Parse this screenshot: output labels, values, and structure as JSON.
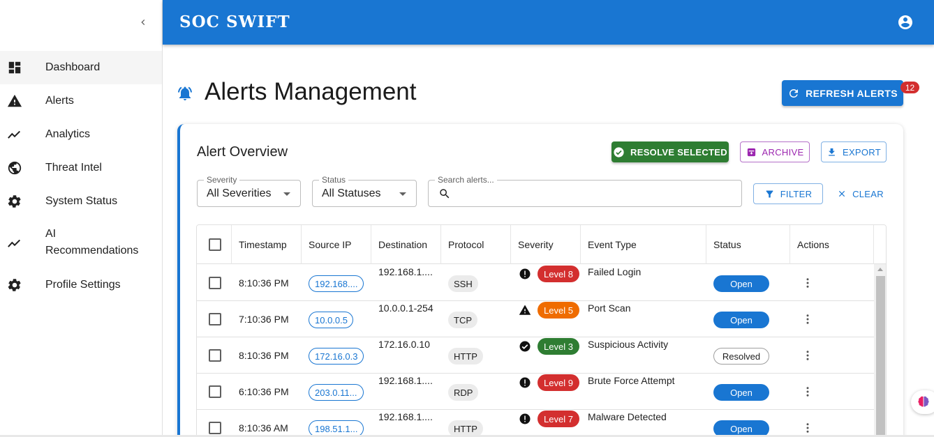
{
  "app": {
    "brand": "SOC SWIFT"
  },
  "sidebar": {
    "items": [
      {
        "label": "Dashboard",
        "icon": "dashboard-icon",
        "active": true
      },
      {
        "label": "Alerts",
        "icon": "warning-icon"
      },
      {
        "label": "Analytics",
        "icon": "trending-icon"
      },
      {
        "label": "Threat Intel",
        "icon": "globe-icon"
      },
      {
        "label": "System Status",
        "icon": "gear-icon"
      },
      {
        "label_line1": "AI",
        "label_line2": "Recommendations",
        "icon": "trending-icon"
      },
      {
        "label": "Profile Settings",
        "icon": "gear-icon"
      }
    ]
  },
  "header": {
    "title": "Alerts Management",
    "refresh_label": "REFRESH ALERTS",
    "badge_count": "12"
  },
  "card": {
    "title": "Alert Overview",
    "resolve_label": "RESOLVE SELECTED",
    "archive_label": "ARCHIVE",
    "export_label": "EXPORT"
  },
  "filters": {
    "severity": {
      "label": "Severity",
      "value": "All Severities"
    },
    "status": {
      "label": "Status",
      "value": "All Statuses"
    },
    "search": {
      "label": "Search alerts...",
      "value": ""
    },
    "filter_label": "FILTER",
    "clear_label": "CLEAR"
  },
  "table": {
    "columns": [
      "Timestamp",
      "Source IP",
      "Destination",
      "Protocol",
      "Severity",
      "Event Type",
      "Status",
      "Actions"
    ],
    "rows": [
      {
        "timestamp": "8:10:36 PM",
        "source_ip": "192.168....",
        "destination": "192.168.1....",
        "protocol": "SSH",
        "severity": "Level 8",
        "sev_icon": "error",
        "event_type": "Failed Login",
        "status": "Open"
      },
      {
        "timestamp": "7:10:36 PM",
        "source_ip": "10.0.0.5",
        "destination": "10.0.0.1-254",
        "protocol": "TCP",
        "severity": "Level 5",
        "sev_icon": "warning",
        "event_type": "Port Scan",
        "status": "Open"
      },
      {
        "timestamp": "8:10:36 PM",
        "source_ip": "172.16.0.3",
        "destination": "172.16.0.10",
        "protocol": "HTTP",
        "severity": "Level 3",
        "sev_icon": "check",
        "event_type": "Suspicious Activity",
        "status": "Resolved"
      },
      {
        "timestamp": "6:10:36 PM",
        "source_ip": "203.0.11...",
        "destination": "192.168.1....",
        "protocol": "RDP",
        "severity": "Level 9",
        "sev_icon": "error",
        "event_type": "Brute Force Attempt",
        "status": "Open"
      },
      {
        "timestamp": "8:10:36 AM",
        "source_ip": "198.51.1...",
        "destination": "192.168.1....",
        "protocol": "HTTP",
        "severity": "Level 7",
        "sev_icon": "error",
        "event_type": "Malware Detected",
        "status": "Open"
      }
    ]
  },
  "colors": {
    "primary": "#1976d2",
    "success": "#2e7d32",
    "danger": "#d32f2f",
    "warning": "#ef6c00",
    "archive": "#9c27b0"
  }
}
